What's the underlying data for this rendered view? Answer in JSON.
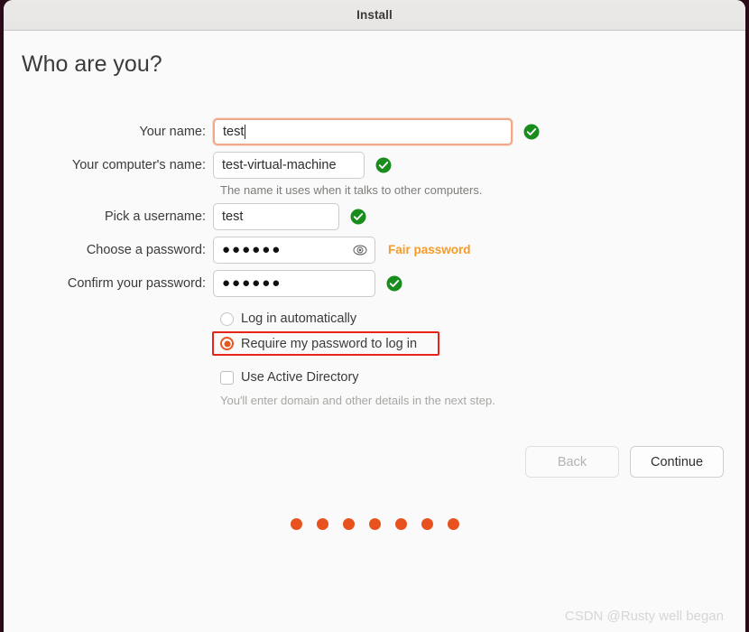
{
  "window": {
    "title": "Install"
  },
  "page": {
    "heading": "Who are you?"
  },
  "form": {
    "name": {
      "label": "Your name:",
      "value": "test",
      "valid_icon": "check-circle-icon"
    },
    "hostname": {
      "label": "Your computer's name:",
      "value": "test-virtual-machine",
      "helper": "The name it uses when it talks to other computers.",
      "valid_icon": "check-circle-icon"
    },
    "username": {
      "label": "Pick a username:",
      "value": "test",
      "valid_icon": "check-circle-icon"
    },
    "password": {
      "label": "Choose a password:",
      "value": "●●●●●●",
      "reveal_icon": "eye-icon",
      "strength": "Fair password"
    },
    "confirm_password": {
      "label": "Confirm your password:",
      "value": "●●●●●●",
      "valid_icon": "check-circle-icon"
    }
  },
  "options": {
    "login_auto": {
      "label": "Log in automatically",
      "selected": false
    },
    "require_password": {
      "label": "Require my password to log in",
      "selected": true,
      "highlighted": true
    },
    "active_directory": {
      "label": "Use Active Directory",
      "checked": false,
      "helper": "You'll enter domain and other details in the next step."
    }
  },
  "footer": {
    "back_label": "Back",
    "back_disabled": true,
    "continue_label": "Continue"
  },
  "progress": {
    "dot_count": 7,
    "dot_color": "#e8521f"
  },
  "watermark": {
    "text": "CSDN @Rusty well began"
  },
  "colors": {
    "accent": "#e8521f",
    "valid_green": "#198c1e",
    "warning_orange": "#f89b26",
    "highlight_red": "#e8231a",
    "focus_border": "#f0a889",
    "window_bg": "#fafafa",
    "titlebar_bg": "#e9e7e5",
    "desktop_bg": "#2c0b18"
  }
}
